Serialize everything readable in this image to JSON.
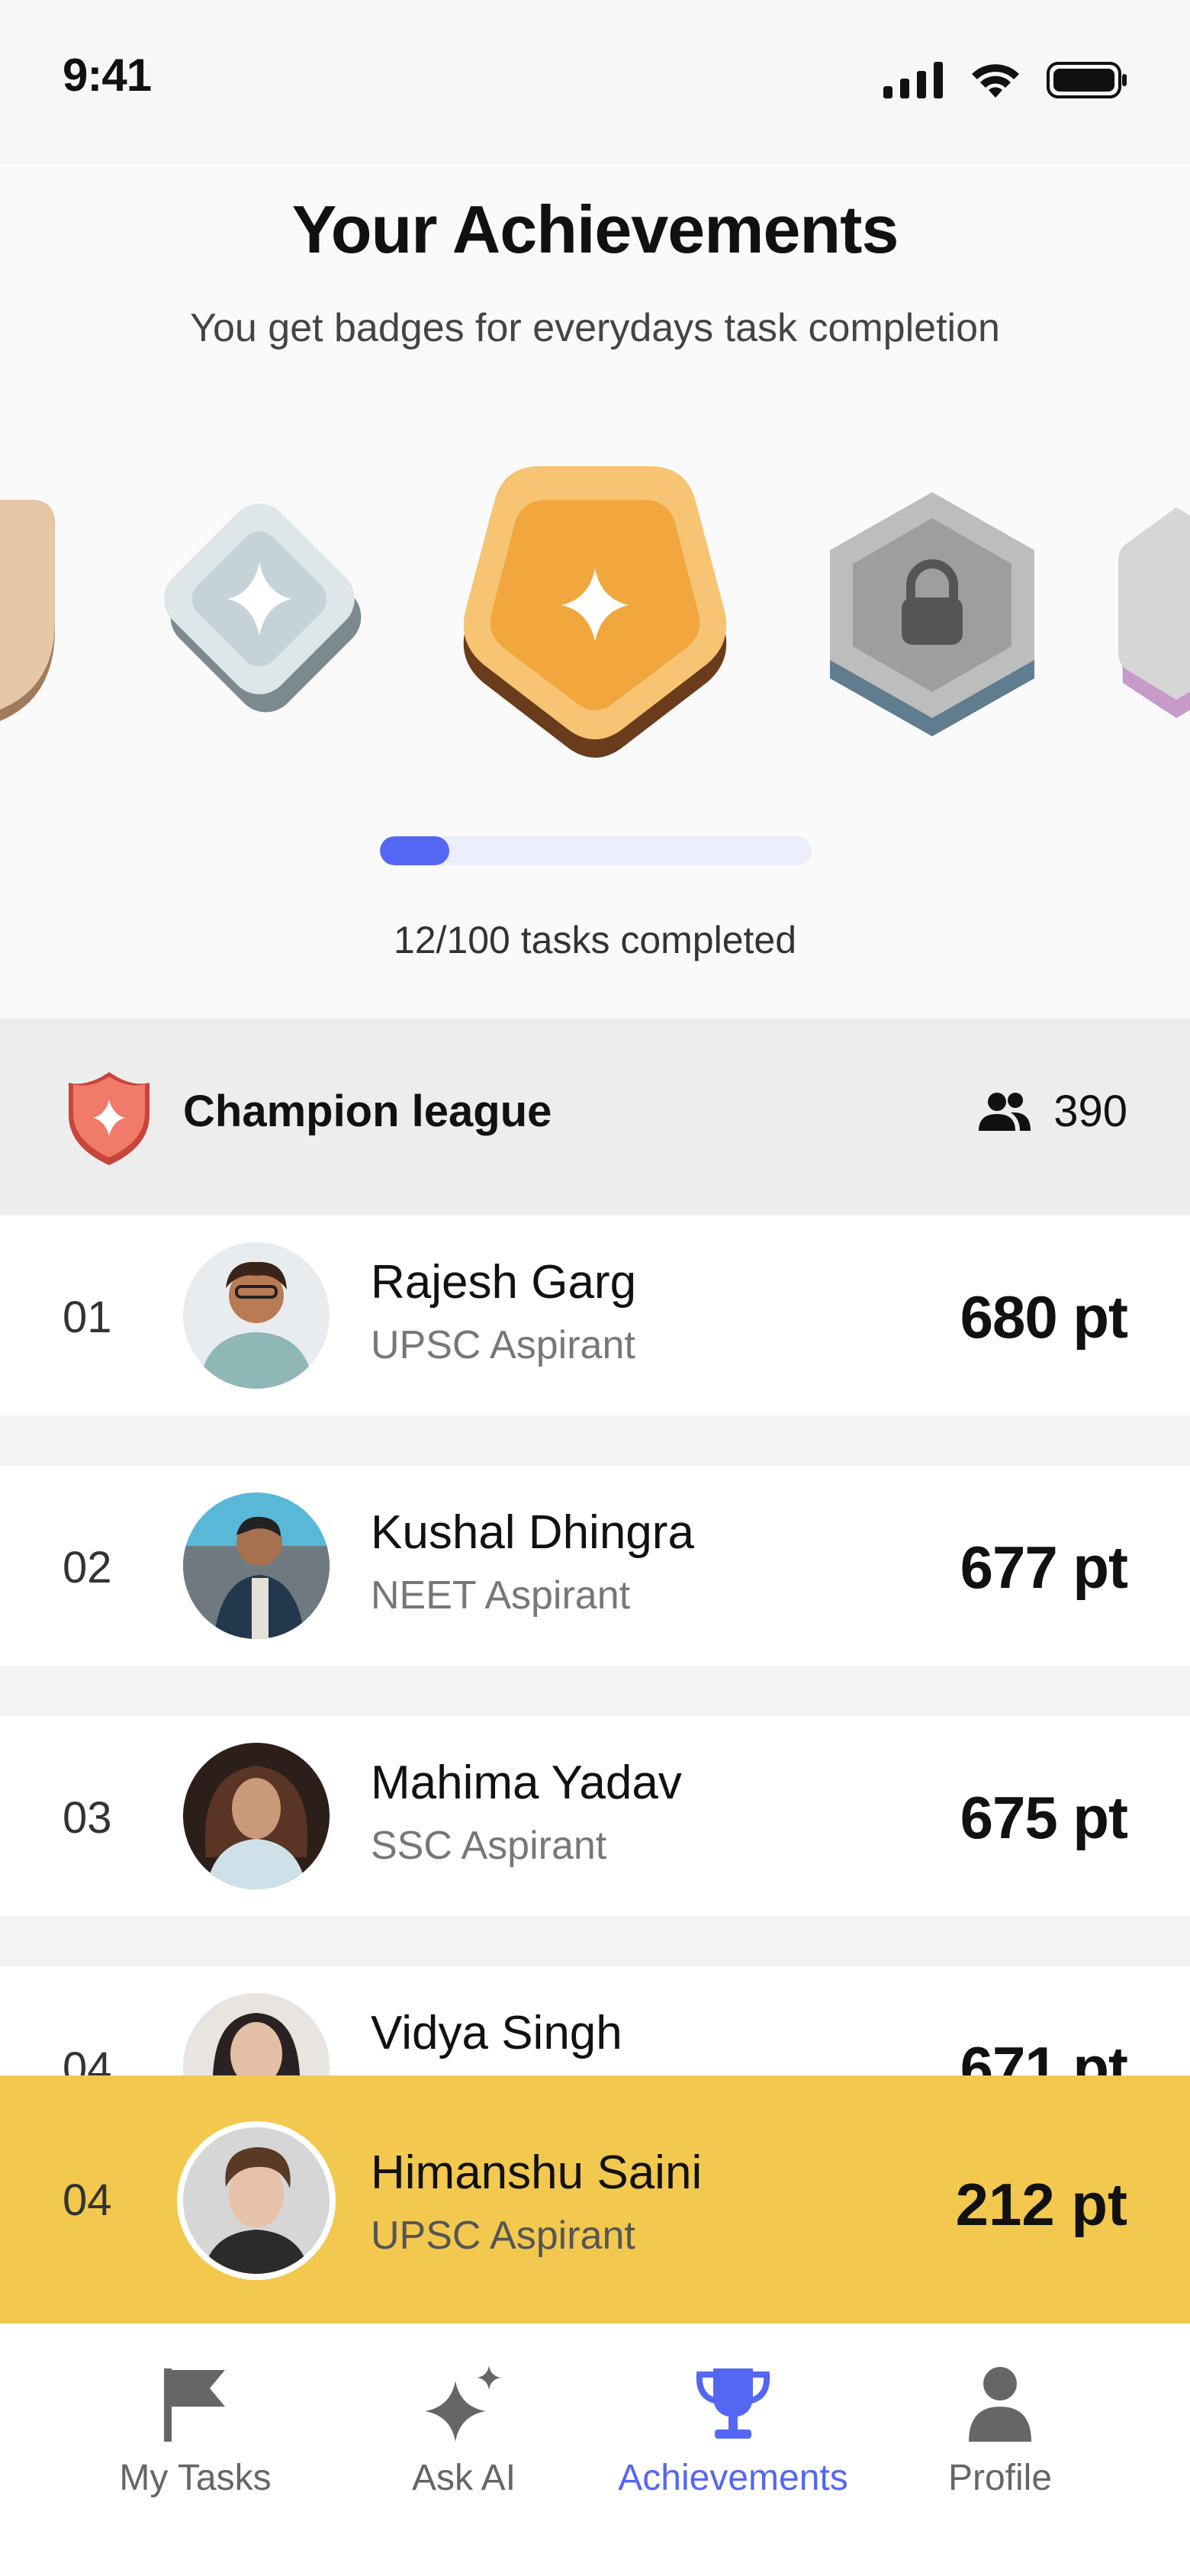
{
  "status_bar": {
    "time": "9:41"
  },
  "header": {
    "title": "Your Achievements",
    "subtitle": "You get badges for everydays task completion"
  },
  "badges": [
    {
      "icon": "partial-badge-icon",
      "color": "#d9b894"
    },
    {
      "icon": "silver-star-badge-icon",
      "color": "#cfd9de"
    },
    {
      "icon": "gold-star-badge-icon",
      "color": "#f2b45a"
    },
    {
      "icon": "locked-badge-icon",
      "color": "#9e9e9e"
    },
    {
      "icon": "partial-badge-icon",
      "color": "#cfcfcf"
    }
  ],
  "progress": {
    "completed": 12,
    "total": 100,
    "fraction": 0.12,
    "text": "12/100 tasks completed",
    "accent": "#5467f2"
  },
  "league": {
    "name": "Champion league",
    "members": "390"
  },
  "leaderboard": [
    {
      "rank": "01",
      "name": "Rajesh Garg",
      "role": "UPSC Aspirant",
      "points": "680 pt"
    },
    {
      "rank": "02",
      "name": "Kushal Dhingra",
      "role": "NEET Aspirant",
      "points": "677 pt"
    },
    {
      "rank": "03",
      "name": "Mahima Yadav",
      "role": "SSC Aspirant",
      "points": "675 pt"
    },
    {
      "rank": "04",
      "name": "Vidya Singh",
      "role": "",
      "points": "671 pt"
    }
  ],
  "current_user": {
    "rank": "04",
    "name": "Himanshu Saini",
    "role": "UPSC Aspirant",
    "points": "212 pt",
    "highlight": "#f2c84e"
  },
  "tabs": [
    {
      "label": "My Tasks",
      "icon": "flag-icon"
    },
    {
      "label": "Ask AI",
      "icon": "sparkle-icon"
    },
    {
      "label": "Achievements",
      "icon": "trophy-icon",
      "active": true
    },
    {
      "label": "Profile",
      "icon": "person-icon"
    }
  ]
}
